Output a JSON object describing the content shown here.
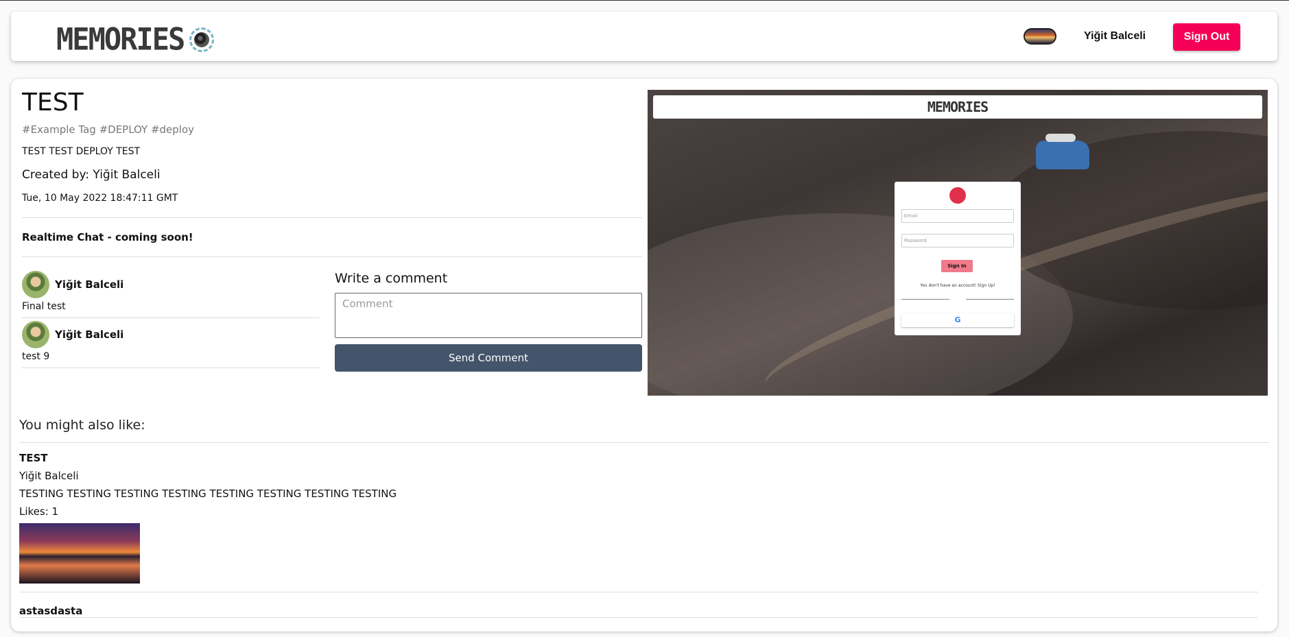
{
  "header": {
    "brand": "MEMORIES",
    "user_name": "Yiğit Balceli",
    "signout_label": "Sign Out"
  },
  "post": {
    "title": "TEST",
    "tags": "#Example Tag #DEPLOY #deploy",
    "message": "TEST TEST DEPLOY TEST",
    "creator": "Created by: Yiğit Balceli",
    "created_at": "Tue, 10 May 2022 18:47:11 GMT",
    "realtime_note": "Realtime Chat - coming soon!"
  },
  "comments": [
    {
      "author": "Yiğit Balceli",
      "text": "Final test"
    },
    {
      "author": "Yiğit Balceli",
      "text": "test 9"
    }
  ],
  "comment_form": {
    "label": "Write a comment",
    "placeholder": "Comment",
    "value": "",
    "send_label": "Send Comment"
  },
  "post_image": {
    "brand": "MEMORIES",
    "email_placeholder": "Email",
    "password_placeholder": "Password",
    "signin_label": "Sign In",
    "no_account_text": "You don't have an account! Sign Up!",
    "or_text": "",
    "google_label": "G"
  },
  "recommended": {
    "heading": "You might also like:",
    "items": [
      {
        "title": "TEST",
        "author": "Yiğit Balceli",
        "message": "TESTING TESTING TESTING TESTING TESTING TESTING TESTING TESTING",
        "likes": "Likes: 1"
      },
      {
        "title": "astasdasta"
      }
    ]
  },
  "colors": {
    "signout_bg": "#f50057",
    "send_bg": "#44546a",
    "tags": "#777777"
  }
}
